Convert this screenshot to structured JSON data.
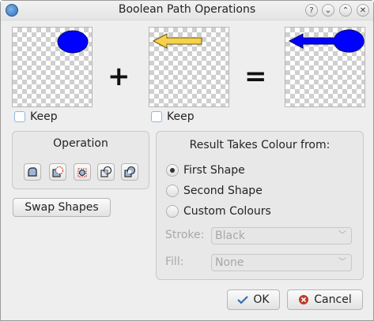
{
  "window": {
    "title": "Boolean Path Operations"
  },
  "titlebar_buttons": [
    "help-icon",
    "minimize-icon",
    "maximize-icon",
    "close-icon"
  ],
  "preview": {
    "plus": "+",
    "equals": "="
  },
  "keep_left": {
    "label": "Keep",
    "checked": false
  },
  "keep_right": {
    "label": "Keep",
    "checked": false
  },
  "operation": {
    "title": "Operation",
    "buttons": [
      "union-icon",
      "difference-icon",
      "reverse-difference-icon",
      "intersection-icon",
      "exclusion-icon"
    ]
  },
  "swap_button": "Swap Shapes",
  "result": {
    "title": "Result Takes Colour from:",
    "options": [
      "First Shape",
      "Second Shape",
      "Custom Colours"
    ],
    "selected": "First Shape",
    "stroke_label": "Stroke:",
    "stroke_value": "Black",
    "fill_label": "Fill:",
    "fill_value": "None"
  },
  "buttons": {
    "ok": "OK",
    "cancel": "Cancel"
  },
  "colors": {
    "shape_blue": "#0000ff",
    "arrow_yellow": "#f5d24a",
    "ok_check": "#3a6fb0",
    "cancel_red": "#c0392b"
  }
}
